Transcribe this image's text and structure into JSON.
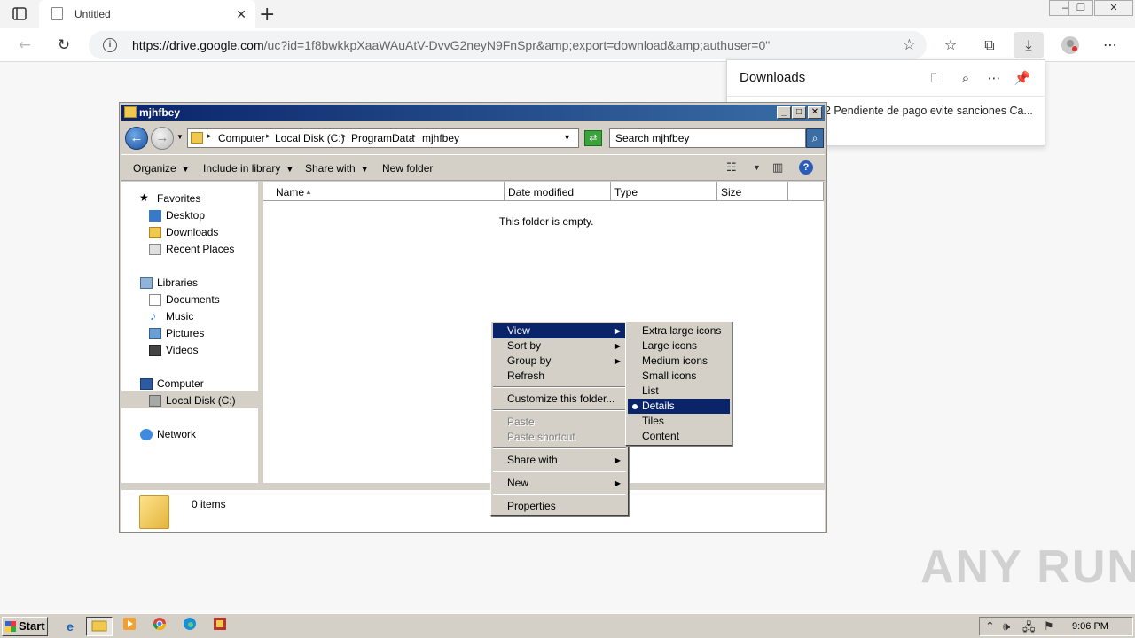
{
  "browser": {
    "tab_title": "Untitled",
    "url_host": "https://drive.google.com",
    "url_path": "/uc?id=1f8bwkkpXaaWAuAtV-DvvG2neyN9FnSpr&amp;export=download&amp;authuser=0\""
  },
  "downloads": {
    "title": "Downloads",
    "item": "2 Pendiente de pago evite sanciones Ca..."
  },
  "explorer": {
    "title": "mjhfbey",
    "breadcrumb": [
      "Computer",
      "Local Disk (C:)",
      "ProgramData",
      "mjhfbey"
    ],
    "search_placeholder": "Search mjhfbey",
    "commands": {
      "organize": "Organize",
      "include": "Include in library",
      "share": "Share with",
      "new_folder": "New folder"
    },
    "nav": {
      "favorites": "Favorites",
      "desktop": "Desktop",
      "downloads": "Downloads",
      "recent": "Recent Places",
      "libraries": "Libraries",
      "documents": "Documents",
      "music": "Music",
      "pictures": "Pictures",
      "videos": "Videos",
      "computer": "Computer",
      "local_disk": "Local Disk (C:)",
      "network": "Network"
    },
    "columns": {
      "name": "Name",
      "date": "Date modified",
      "type": "Type",
      "size": "Size"
    },
    "empty_text": "This folder is empty.",
    "items_count": "0 items"
  },
  "context_menu": {
    "view": "View",
    "sort_by": "Sort by",
    "group_by": "Group by",
    "refresh": "Refresh",
    "customize": "Customize this folder...",
    "paste": "Paste",
    "paste_shortcut": "Paste shortcut",
    "share_with": "Share with",
    "new": "New",
    "properties": "Properties"
  },
  "view_submenu": {
    "extra_large": "Extra large icons",
    "large": "Large icons",
    "medium": "Medium icons",
    "small": "Small icons",
    "list": "List",
    "details": "Details",
    "tiles": "Tiles",
    "content": "Content",
    "selected": "Details"
  },
  "taskbar": {
    "start": "Start",
    "clock": "9:06 PM"
  },
  "watermark": "ANY RUN",
  "colors": {
    "title_bar": "#0a246a",
    "menu_highlight": "#0a246a",
    "win_face": "#d4d0c8"
  }
}
